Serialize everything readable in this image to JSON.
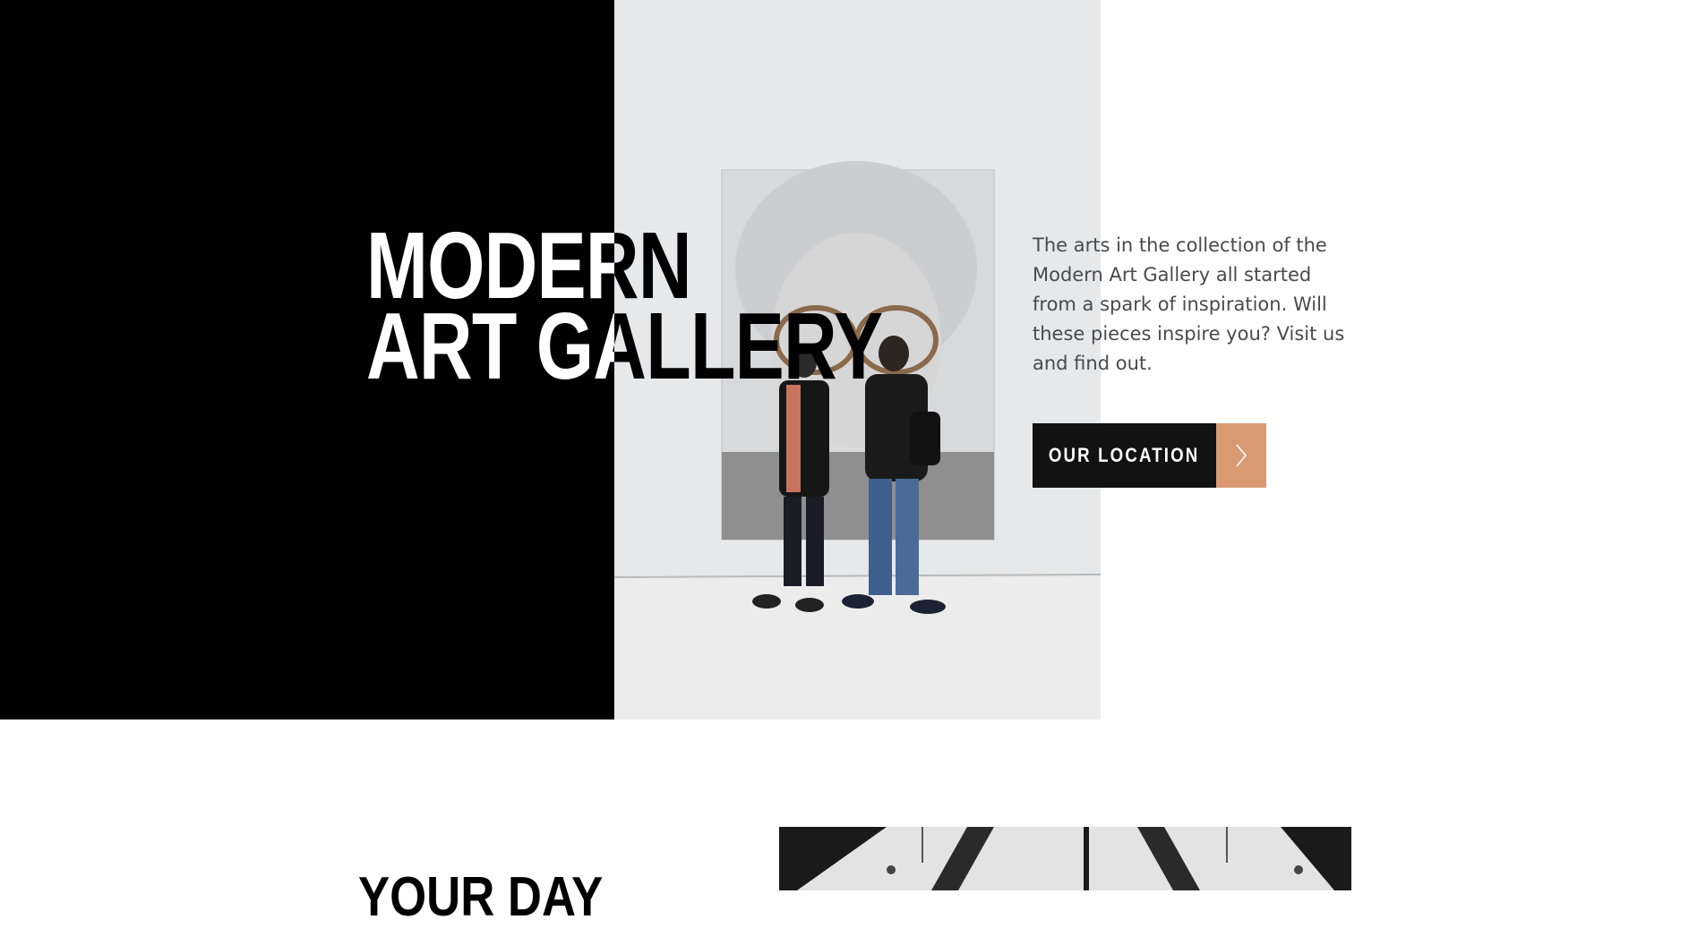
{
  "hero": {
    "title_line1": "MODERN",
    "title_line2": "ART GALLERY",
    "description": "The arts in the collection of the Modern Art Gallery all started from a spark of inspiration. Will these pieces inspire you? Visit us and find out.",
    "cta_label": "OUR LOCATION",
    "cta_icon": "chevron-right-icon"
  },
  "section2": {
    "heading": "YOUR DAY"
  },
  "colors": {
    "panel": "#000000",
    "accent": "#d99a73",
    "button": "#121212",
    "text": "#4a4a4a"
  }
}
